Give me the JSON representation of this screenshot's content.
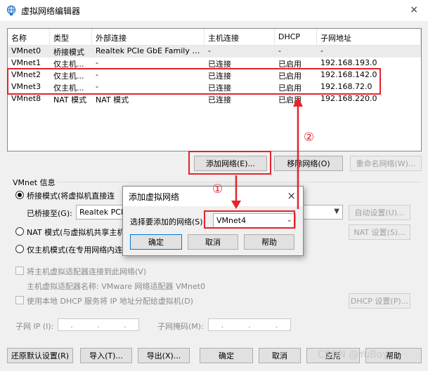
{
  "window": {
    "title": "虚拟网络编辑器",
    "icon": "globe-network-icon",
    "close_label": "×"
  },
  "table": {
    "columns": [
      "名称",
      "类型",
      "外部连接",
      "主机连接",
      "DHCP",
      "子网地址"
    ],
    "rows": [
      [
        "VMnet0",
        "桥接模式",
        "Realtek PCIe GbE Family Co...",
        "-",
        "-",
        "-"
      ],
      [
        "VMnet1",
        "仅主机...",
        "-",
        "已连接",
        "已启用",
        "192.168.193.0"
      ],
      [
        "VMnet2",
        "仅主机...",
        "-",
        "已连接",
        "已启用",
        "192.168.142.0"
      ],
      [
        "VMnet3",
        "仅主机...",
        "-",
        "已连接",
        "已启用",
        "192.168.72.0"
      ],
      [
        "VMnet8",
        "NAT 模式",
        "NAT 模式",
        "已连接",
        "已启用",
        "192.168.220.0"
      ]
    ]
  },
  "list_buttons": {
    "add": "添加网络(E)...",
    "remove": "移除网络(O)",
    "rename": "重命名网络(W)..."
  },
  "vmnet_info": {
    "group_label": "VMnet 信息",
    "bridged_radio": "桥接模式(将虚拟机直接连",
    "bridged_to_label": "已桥接至(G):",
    "bridged_to_value": "Realtek PCIe",
    "auto_settings": "自动设置(U)...",
    "nat_radio": "NAT 模式(与虚拟机共享主机",
    "nat_settings": "NAT 设置(S)...",
    "hostonly_radio": "仅主机模式(在专用网络内连",
    "connect_adapter": "将主机虚拟适配器连接到此网络(V)",
    "adapter_name": "主机虚拟适配器名称: VMware 网络适配器 VMnet0",
    "use_dhcp": "使用本地 DHCP 服务将 IP 地址分配给虚拟机(D)",
    "dhcp_settings": "DHCP 设置(P)...",
    "subnet_ip_label": "子网 IP (I):",
    "subnet_mask_label": "子网掩码(M):",
    "ip_dots": "."
  },
  "bottom_buttons": {
    "restore": "还原默认设置(R)",
    "import": "导入(T)...",
    "export": "导出(X)...",
    "ok": "确定",
    "cancel": "取消",
    "apply": "应用",
    "help": "帮助"
  },
  "dialog": {
    "title": "添加虚拟网络",
    "close_label": "×",
    "select_label": "选择要添加的网络(S):",
    "selected": "VMnet4",
    "ok": "确定",
    "cancel": "取消",
    "help": "帮助"
  },
  "annotations": {
    "step1": "①",
    "step2": "②",
    "color": "#e5232b"
  },
  "watermark": "CSDN @YuBoy"
}
